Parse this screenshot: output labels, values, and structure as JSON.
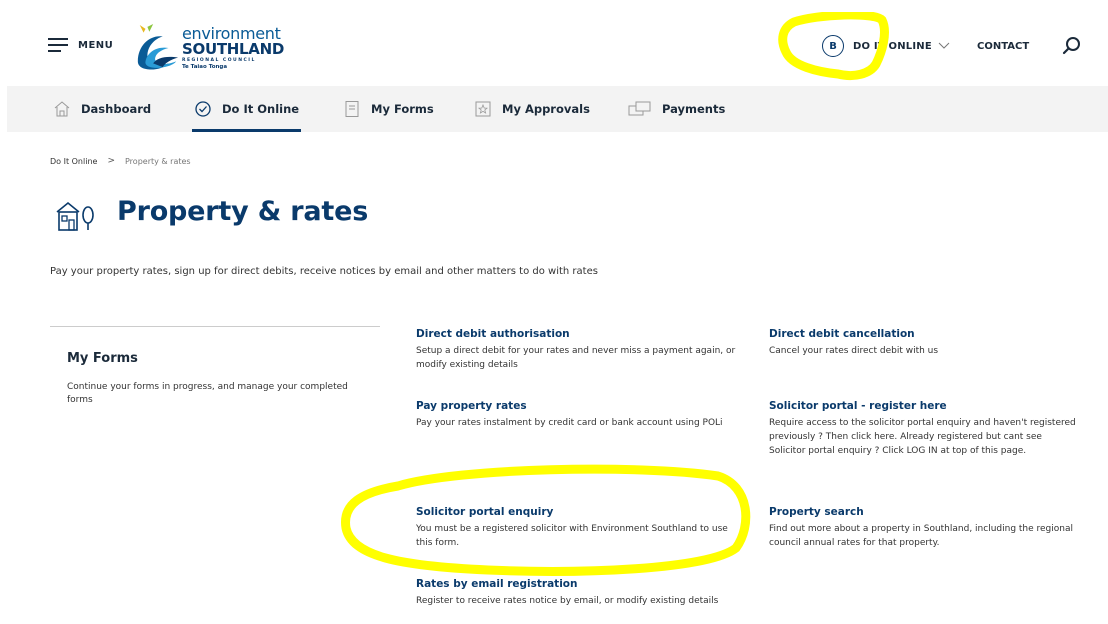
{
  "header": {
    "menu_label": "MENU",
    "logo": {
      "line1": "environment",
      "line2": "SOUTHLAND",
      "line3": "REGIONAL COUNCIL",
      "line4": "Te Taiao Tonga"
    },
    "user_initial": "B",
    "online_label": "DO IT ONLINE",
    "contact_label": "CONTACT",
    "search_icon": "search-icon"
  },
  "tabs": [
    {
      "label": "Dashboard",
      "icon": "home-icon"
    },
    {
      "label": "Do It Online",
      "icon": "check-circle-icon",
      "active": true
    },
    {
      "label": "My Forms",
      "icon": "document-icon"
    },
    {
      "label": "My Approvals",
      "icon": "approval-icon"
    },
    {
      "label": "Payments",
      "icon": "payment-icon"
    }
  ],
  "breadcrumb": {
    "root": "Do It Online",
    "separator": ">",
    "current": "Property & rates"
  },
  "page": {
    "title": "Property & rates",
    "description": "Pay your property rates, sign up for direct debits, receive notices by email and other matters to do with rates",
    "icon": "house-tree-icon"
  },
  "my_forms": {
    "title": "My Forms",
    "description": "Continue your forms in progress, and manage your completed forms"
  },
  "items": [
    {
      "title": "Direct debit authorisation",
      "desc": "Setup a direct debit for your rates and never miss a payment again, or modify existing details"
    },
    {
      "title": "Direct debit cancellation",
      "desc": "Cancel your rates direct debit with us"
    },
    {
      "title": "Pay property rates",
      "desc": "Pay your rates instalment by credit card or bank account using POLi"
    },
    {
      "title": "Solicitor portal - register here",
      "desc": "Require access to the solicitor portal enquiry and haven't registered previously ? Then click here. Already registered but cant see Solicitor portal enquiry ? Click LOG IN at top of this page."
    },
    {
      "title": "Solicitor portal enquiry",
      "desc": "You must be a registered solicitor with Environment Southland to use this form."
    },
    {
      "title": "Property search",
      "desc": "Find out more about a property in Southland, including the regional council annual rates for that property."
    },
    {
      "title": "Rates by email registration",
      "desc": "Register to receive rates notice by email, or modify existing details"
    }
  ],
  "colors": {
    "brand": "#0a3a6b",
    "tab_bar": "#f3f3f3",
    "highlight": "#ffff00"
  }
}
